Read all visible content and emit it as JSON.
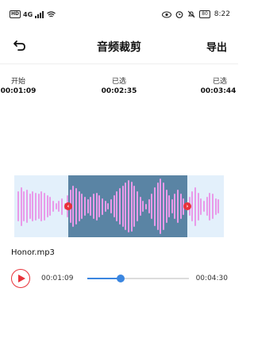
{
  "status_bar": {
    "net": "HD",
    "signal": "4G",
    "battery": "80",
    "time": "8:22"
  },
  "header": {
    "title": "音频裁剪",
    "export_label": "导出",
    "back_icon": "back-arrow-icon"
  },
  "times": {
    "start_label": "开始",
    "start_value": "00:01:09",
    "selected_label": "已选",
    "selected_value": "00:02:35",
    "end_label": "已选",
    "end_value": "00:03:44"
  },
  "waveform": {
    "selection_start": 0.258,
    "selection_end": 0.826,
    "colors": {
      "background": "#e3f0fb",
      "selection": "#5a84a4",
      "bars": "#e99ae9",
      "handle": "#e8323a"
    },
    "bar_amplitudes": [
      0.55,
      0.7,
      0.55,
      0.6,
      0.45,
      0.55,
      0.5,
      0.45,
      0.55,
      0.5,
      0.4,
      0.35,
      0.2,
      0.12,
      0.2,
      0.3,
      0.12,
      0.4,
      0.6,
      0.75,
      0.65,
      0.55,
      0.45,
      0.35,
      0.25,
      0.35,
      0.45,
      0.5,
      0.4,
      0.3,
      0.2,
      0.12,
      0.25,
      0.4,
      0.55,
      0.65,
      0.75,
      0.85,
      0.95,
      0.9,
      0.75,
      0.55,
      0.35,
      0.2,
      0.1,
      0.25,
      0.45,
      0.7,
      0.85,
      1.0,
      0.85,
      0.6,
      0.4,
      0.25,
      0.45,
      0.6,
      0.45,
      0.3,
      0.15,
      0.35,
      0.55,
      0.7,
      0.5,
      0.3,
      0.2,
      0.35,
      0.5,
      0.45,
      0.3,
      0.25
    ]
  },
  "file": {
    "name": "Honor.mp3"
  },
  "player": {
    "current_time": "00:01:09",
    "duration": "00:04:30",
    "progress": 0.33,
    "accent": "#3b86e0"
  }
}
